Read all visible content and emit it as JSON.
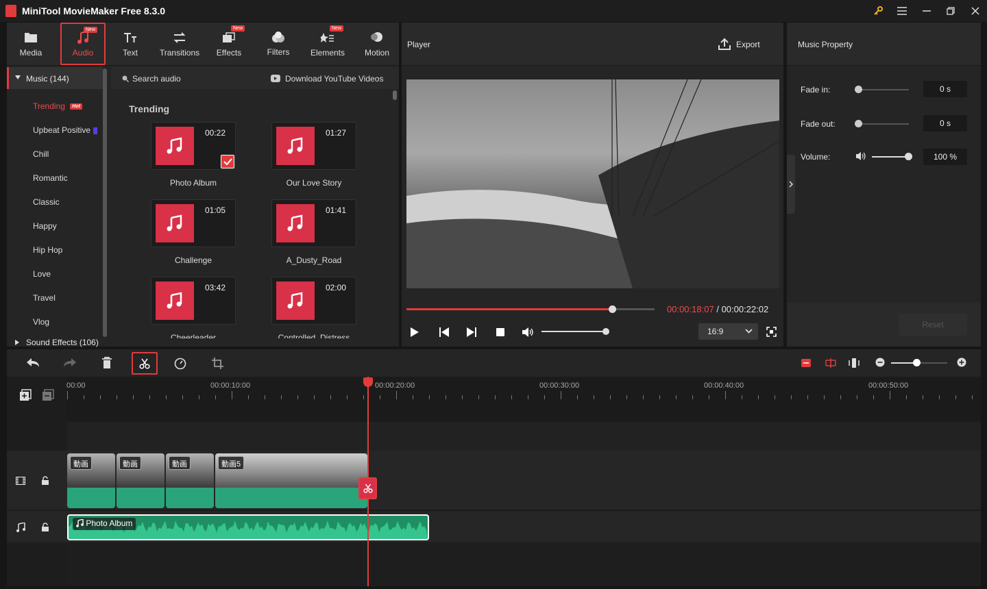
{
  "app": {
    "title": "MiniTool MovieMaker Free 8.3.0"
  },
  "toolbar": {
    "items": [
      {
        "label": "Media"
      },
      {
        "label": "Audio",
        "badge": "New"
      },
      {
        "label": "Text"
      },
      {
        "label": "Transitions"
      },
      {
        "label": "Effects",
        "badge": "New"
      },
      {
        "label": "Filters"
      },
      {
        "label": "Elements",
        "badge": "New"
      },
      {
        "label": "Motion"
      }
    ]
  },
  "sidebar": {
    "music_header": "Music (144)",
    "categories": [
      "Trending",
      "Upbeat Positive",
      "Chill",
      "Romantic",
      "Classic",
      "Happy",
      "Hip Hop",
      "Love",
      "Travel",
      "Vlog"
    ],
    "hot_badge": "Hot",
    "sound_effects": "Sound Effects (106)"
  },
  "audio_library": {
    "search_placeholder": "Search audio",
    "download_label": "Download YouTube Videos",
    "section_title": "Trending",
    "tracks": [
      {
        "name": "Photo Album",
        "duration": "00:22",
        "selected": true
      },
      {
        "name": "Our Love Story",
        "duration": "01:27"
      },
      {
        "name": "Challenge",
        "duration": "01:05"
      },
      {
        "name": "A_Dusty_Road",
        "duration": "01:41"
      },
      {
        "name": "Cheerleader",
        "duration": "03:42"
      },
      {
        "name": "Controlled_Distress",
        "duration": "02:00"
      }
    ]
  },
  "player": {
    "title": "Player",
    "export_label": "Export",
    "current_time": "00:00:18:07",
    "separator": "/",
    "total_time": "00:00:22:02",
    "progress": 0.83,
    "volume": 1.0,
    "aspect_ratio": "16:9"
  },
  "music_property": {
    "title": "Music Property",
    "fade_in_label": "Fade in:",
    "fade_in_value": "0 s",
    "fade_out_label": "Fade out:",
    "fade_out_value": "0 s",
    "volume_label": "Volume:",
    "volume_value": "100 %",
    "reset_label": "Reset"
  },
  "timeline": {
    "ruler": [
      "00:00",
      "00:00:10:00",
      "00:00:20:00",
      "00:00:30:00",
      "00:00:40:00",
      "00:00:50:00"
    ],
    "video_clips": [
      "動画",
      "動画",
      "動画",
      "動画5"
    ],
    "audio_clip": "Photo Album",
    "zoom": 0.45
  },
  "colors": {
    "accent": "#e23b3b",
    "panel": "#252526",
    "wave": "#2aa47a",
    "thumb": "#d83148"
  }
}
